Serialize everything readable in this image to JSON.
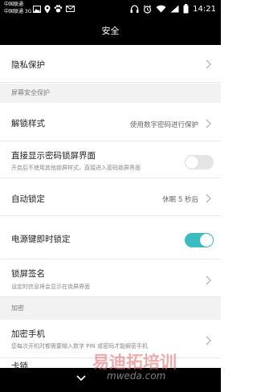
{
  "status_bar": {
    "carrier_1": "中国联通",
    "carrier_2": "中国联通 3G",
    "time": "14:21",
    "icons": [
      "image-icon",
      "location-icon",
      "paw-icon",
      "mail-icon",
      "headset-icon",
      "alarm-icon",
      "wifi-icon",
      "signal-icon",
      "battery-icon"
    ]
  },
  "title": "安全",
  "rows": {
    "privacy": {
      "label": "隐私保护"
    },
    "unlock_style": {
      "label": "解锁样式",
      "value": "使用数字密码进行保护"
    },
    "direct_password": {
      "label": "直接显示密码锁屏界面",
      "sub": "开启后不使用其他锁屏样式，直接进入密码锁屏界面",
      "enabled": false
    },
    "auto_lock": {
      "label": "自动锁定",
      "value": "休眠 5 秒后"
    },
    "power_lock": {
      "label": "电源键即时锁定",
      "enabled": true
    },
    "lockscreen_signature": {
      "label": "锁屏签名",
      "sub": "设定的信息将会显示在锁屏界面"
    },
    "encrypt_phone": {
      "label": "加密手机",
      "sub": "您每次开机时都需要输入数字 PIN 或密码才能解密手机"
    },
    "partial": {
      "label": "卡锁"
    }
  },
  "sections": {
    "screen_security": "屏幕安全保护",
    "encryption": "加密"
  },
  "watermark": {
    "main": "易迪拓培训",
    "sub": "mweda.com"
  },
  "colors": {
    "accent": "#3cbcc0",
    "bar": "#000000",
    "section_bg": "#f2f2f2"
  }
}
